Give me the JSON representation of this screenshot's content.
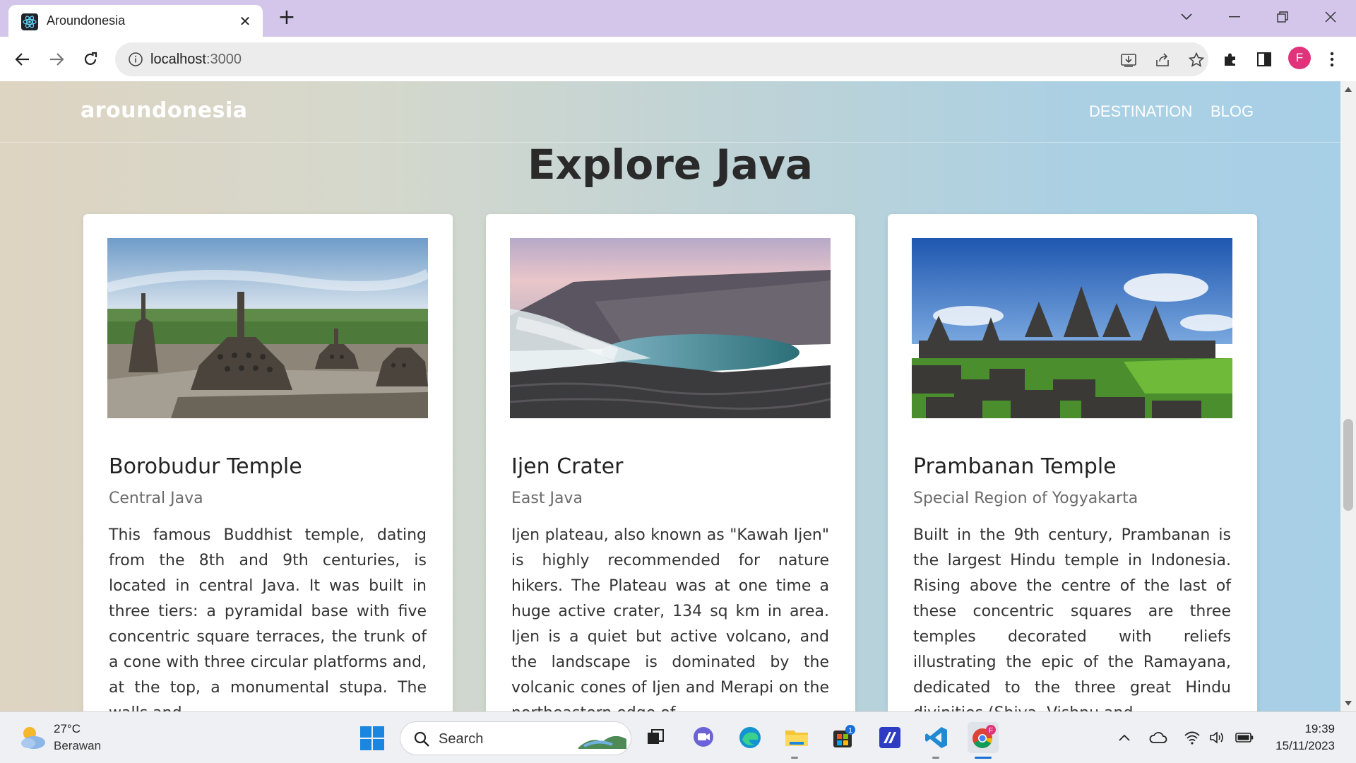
{
  "browser": {
    "tab_title": "Aroundonesia",
    "tab_icon": "react-icon",
    "url_host": "localhost",
    "url_port": ":3000",
    "profile_initial": "F",
    "colors": {
      "tabbar": "#d3c6ea",
      "profile": "#e0337a"
    }
  },
  "site": {
    "brand": "aroundonesia",
    "nav": [
      {
        "label": "DESTINATION"
      },
      {
        "label": "BLOG"
      }
    ],
    "page_title": "Explore Java",
    "cards": [
      {
        "title": "Borobudur Temple",
        "region": "Central Java",
        "description": "This famous Buddhist temple, dating from the 8th and 9th centuries, is located in central Java. It was built in three tiers: a pyramidal base with five concentric square terraces, the trunk of a cone with three circular platforms and, at the top, a monumental stupa. The walls and"
      },
      {
        "title": "Ijen Crater",
        "region": "East Java",
        "description": "Ijen plateau, also known as \"Kawah Ijen\" is highly recommended for nature hikers. The Plateau was at one time a huge active crater, 134 sq km in area. Ijen is a quiet but active volcano, and the landscape is dominated by the volcanic cones of Ijen and Merapi on the northeastern edge of"
      },
      {
        "title": "Prambanan Temple",
        "region": "Special Region of Yogyakarta",
        "description": "Built in the 9th century, Prambanan is the largest Hindu temple in Indonesia. Rising above the centre of the last of these concentric squares are three temples decorated with reliefs illustrating the epic of the Ramayana, dedicated to the three great Hindu divinities (Shiva, Vishnu and"
      }
    ]
  },
  "taskbar": {
    "weather_temp": "27°C",
    "weather_desc": "Berawan",
    "search_label": "Search",
    "store_badge": "1",
    "chrome_badge": "F",
    "time": "19:39",
    "date": "15/11/2023"
  }
}
